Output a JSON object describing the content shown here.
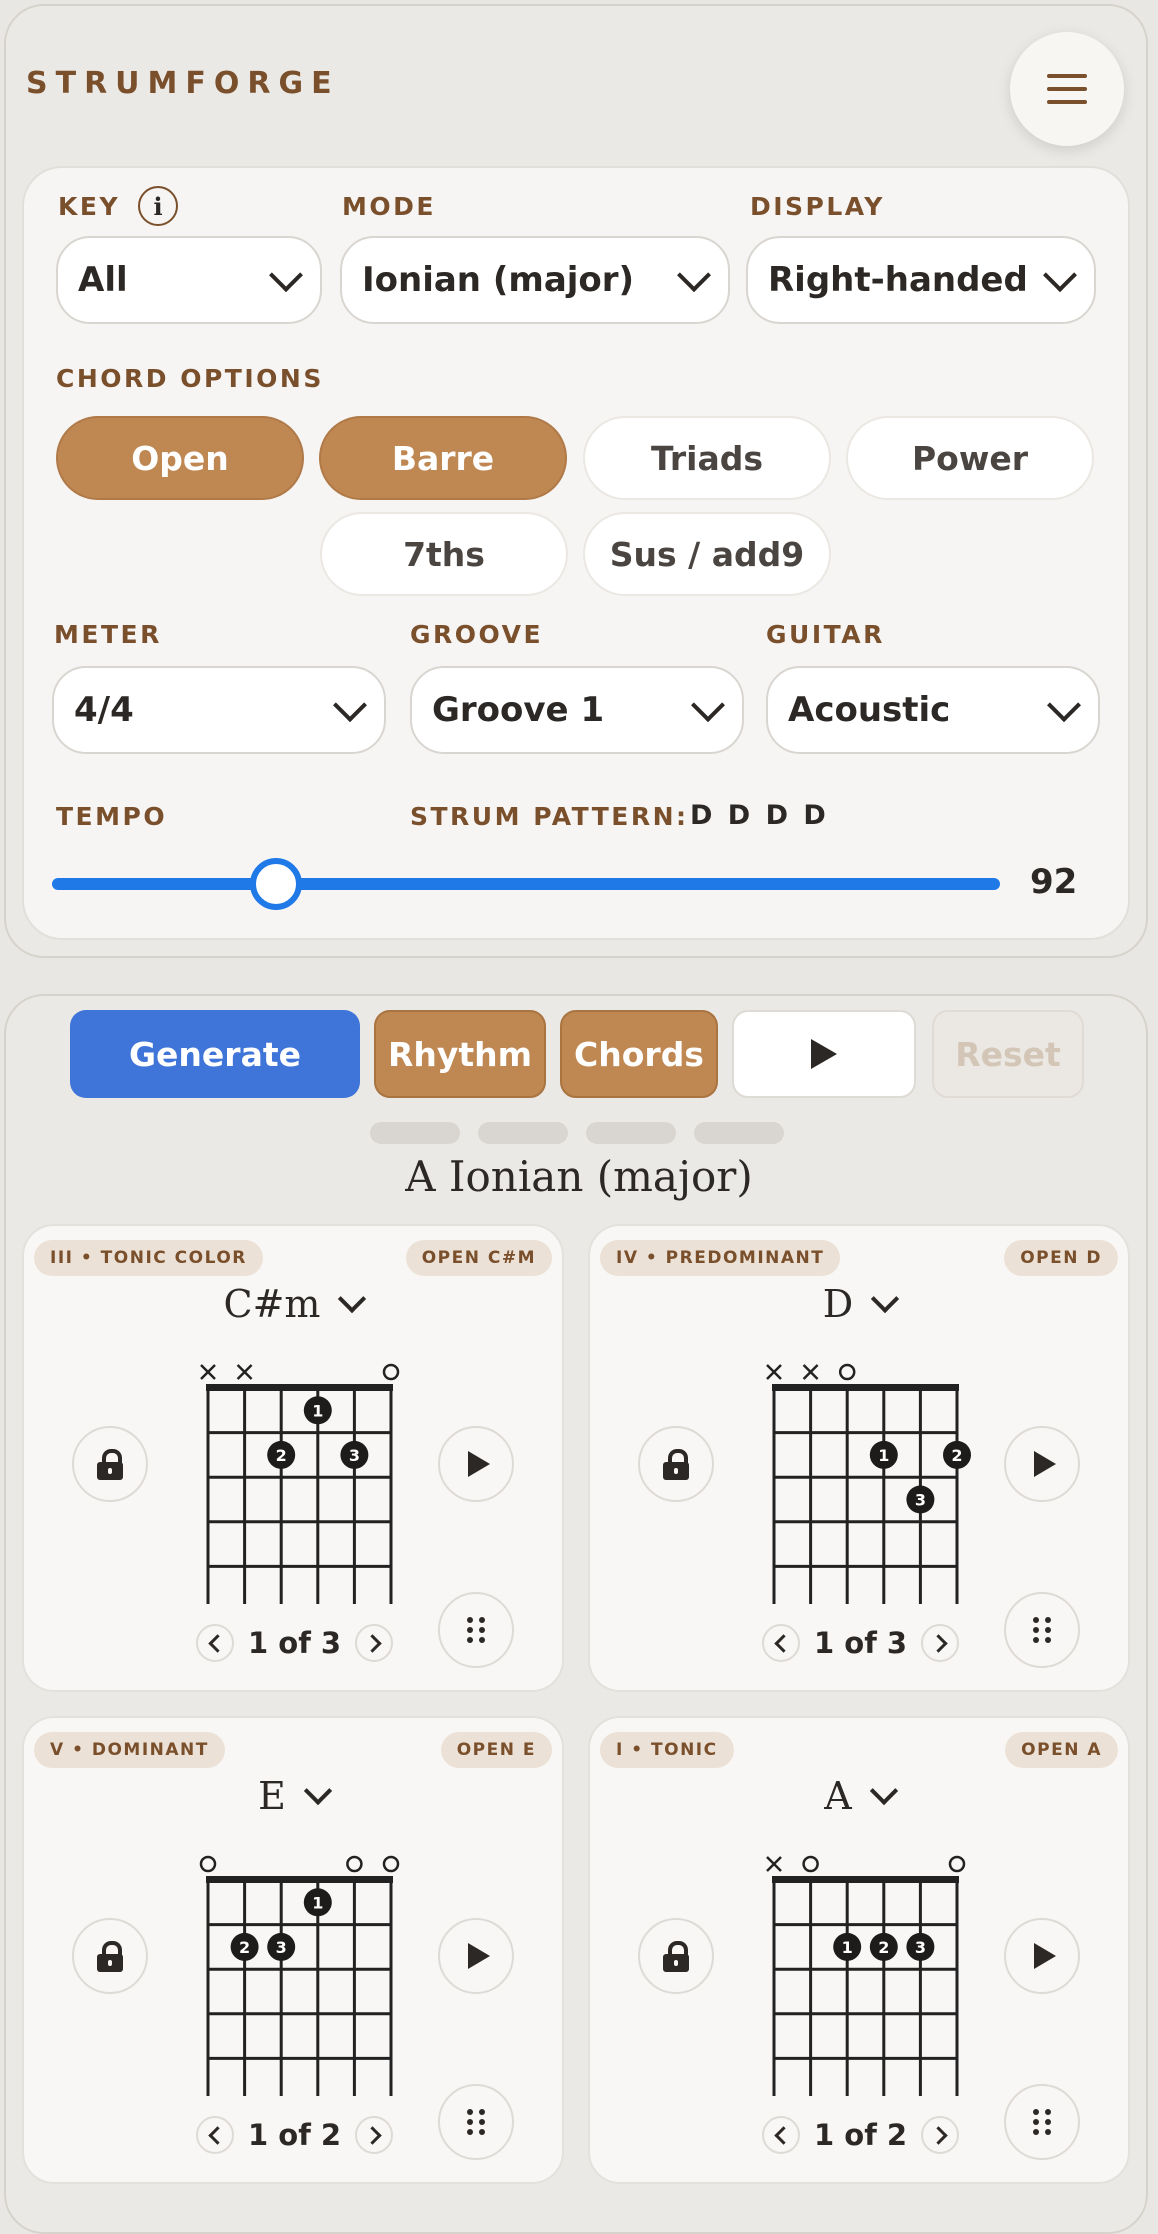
{
  "app": {
    "brand": "STRUMFORGE"
  },
  "settings": {
    "key": {
      "label": "KEY",
      "value": "All"
    },
    "mode": {
      "label": "MODE",
      "value": "Ionian (major)"
    },
    "display": {
      "label": "DISPLAY",
      "value": "Right-handed"
    },
    "chord_options": {
      "label": "CHORD OPTIONS",
      "items": [
        {
          "label": "Open",
          "selected": true
        },
        {
          "label": "Barre",
          "selected": true
        },
        {
          "label": "Triads",
          "selected": false
        },
        {
          "label": "Power",
          "selected": false
        },
        {
          "label": "7ths",
          "selected": false
        },
        {
          "label": "Sus / add9",
          "selected": false
        }
      ]
    },
    "meter": {
      "label": "METER",
      "value": "4/4"
    },
    "groove": {
      "label": "GROOVE",
      "value": "Groove 1"
    },
    "guitar": {
      "label": "GUITAR",
      "value": "Acoustic"
    },
    "tempo": {
      "label": "TEMPO",
      "value": "92",
      "slider_fraction": 0.236
    },
    "strum": {
      "label": "STRUM PATTERN:",
      "pattern": "D D D D"
    }
  },
  "actions": {
    "generate": "Generate",
    "rhythm": "Rhythm",
    "chords": "Chords",
    "reset": "Reset"
  },
  "progression": {
    "title": "A Ionian (major)",
    "chords": [
      {
        "function": "III • TONIC COLOR",
        "voicing": "OPEN C#M",
        "name": "C#m",
        "pager": "1 of 3",
        "marks": [
          "x",
          "x",
          "",
          "",
          "",
          "o"
        ],
        "dots": [
          {
            "string": 4,
            "fret": 1,
            "finger": "1"
          },
          {
            "string": 3,
            "fret": 2,
            "finger": "2"
          },
          {
            "string": 5,
            "fret": 2,
            "finger": "3"
          }
        ]
      },
      {
        "function": "IV • PREDOMINANT",
        "voicing": "OPEN D",
        "name": "D",
        "pager": "1 of 3",
        "marks": [
          "x",
          "x",
          "o",
          "",
          "",
          ""
        ],
        "dots": [
          {
            "string": 4,
            "fret": 2,
            "finger": "1"
          },
          {
            "string": 6,
            "fret": 2,
            "finger": "2"
          },
          {
            "string": 5,
            "fret": 3,
            "finger": "3"
          }
        ]
      },
      {
        "function": "V • DOMINANT",
        "voicing": "OPEN E",
        "name": "E",
        "pager": "1 of 2",
        "marks": [
          "o",
          "",
          "",
          "",
          "o",
          "o"
        ],
        "dots": [
          {
            "string": 4,
            "fret": 1,
            "finger": "1"
          },
          {
            "string": 2,
            "fret": 2,
            "finger": "2"
          },
          {
            "string": 3,
            "fret": 2,
            "finger": "3"
          }
        ]
      },
      {
        "function": "I • TONIC",
        "voicing": "OPEN A",
        "name": "A",
        "pager": "1 of 2",
        "marks": [
          "x",
          "o",
          "",
          "",
          "",
          "o"
        ],
        "dots": [
          {
            "string": 3,
            "fret": 2,
            "finger": "1"
          },
          {
            "string": 4,
            "fret": 2,
            "finger": "2"
          },
          {
            "string": 5,
            "fret": 2,
            "finger": "3"
          }
        ]
      }
    ]
  },
  "icons": {
    "menu": "hamburger-icon",
    "info": "info-icon",
    "chevron": "chevron-down-icon",
    "play": "play-icon",
    "lock": "lock-icon",
    "grip": "grip-icon"
  },
  "colors": {
    "accent": "#bf8752",
    "primary": "#3f74d8",
    "brand": "#7a4f2b",
    "slider": "#1f7ae8"
  }
}
